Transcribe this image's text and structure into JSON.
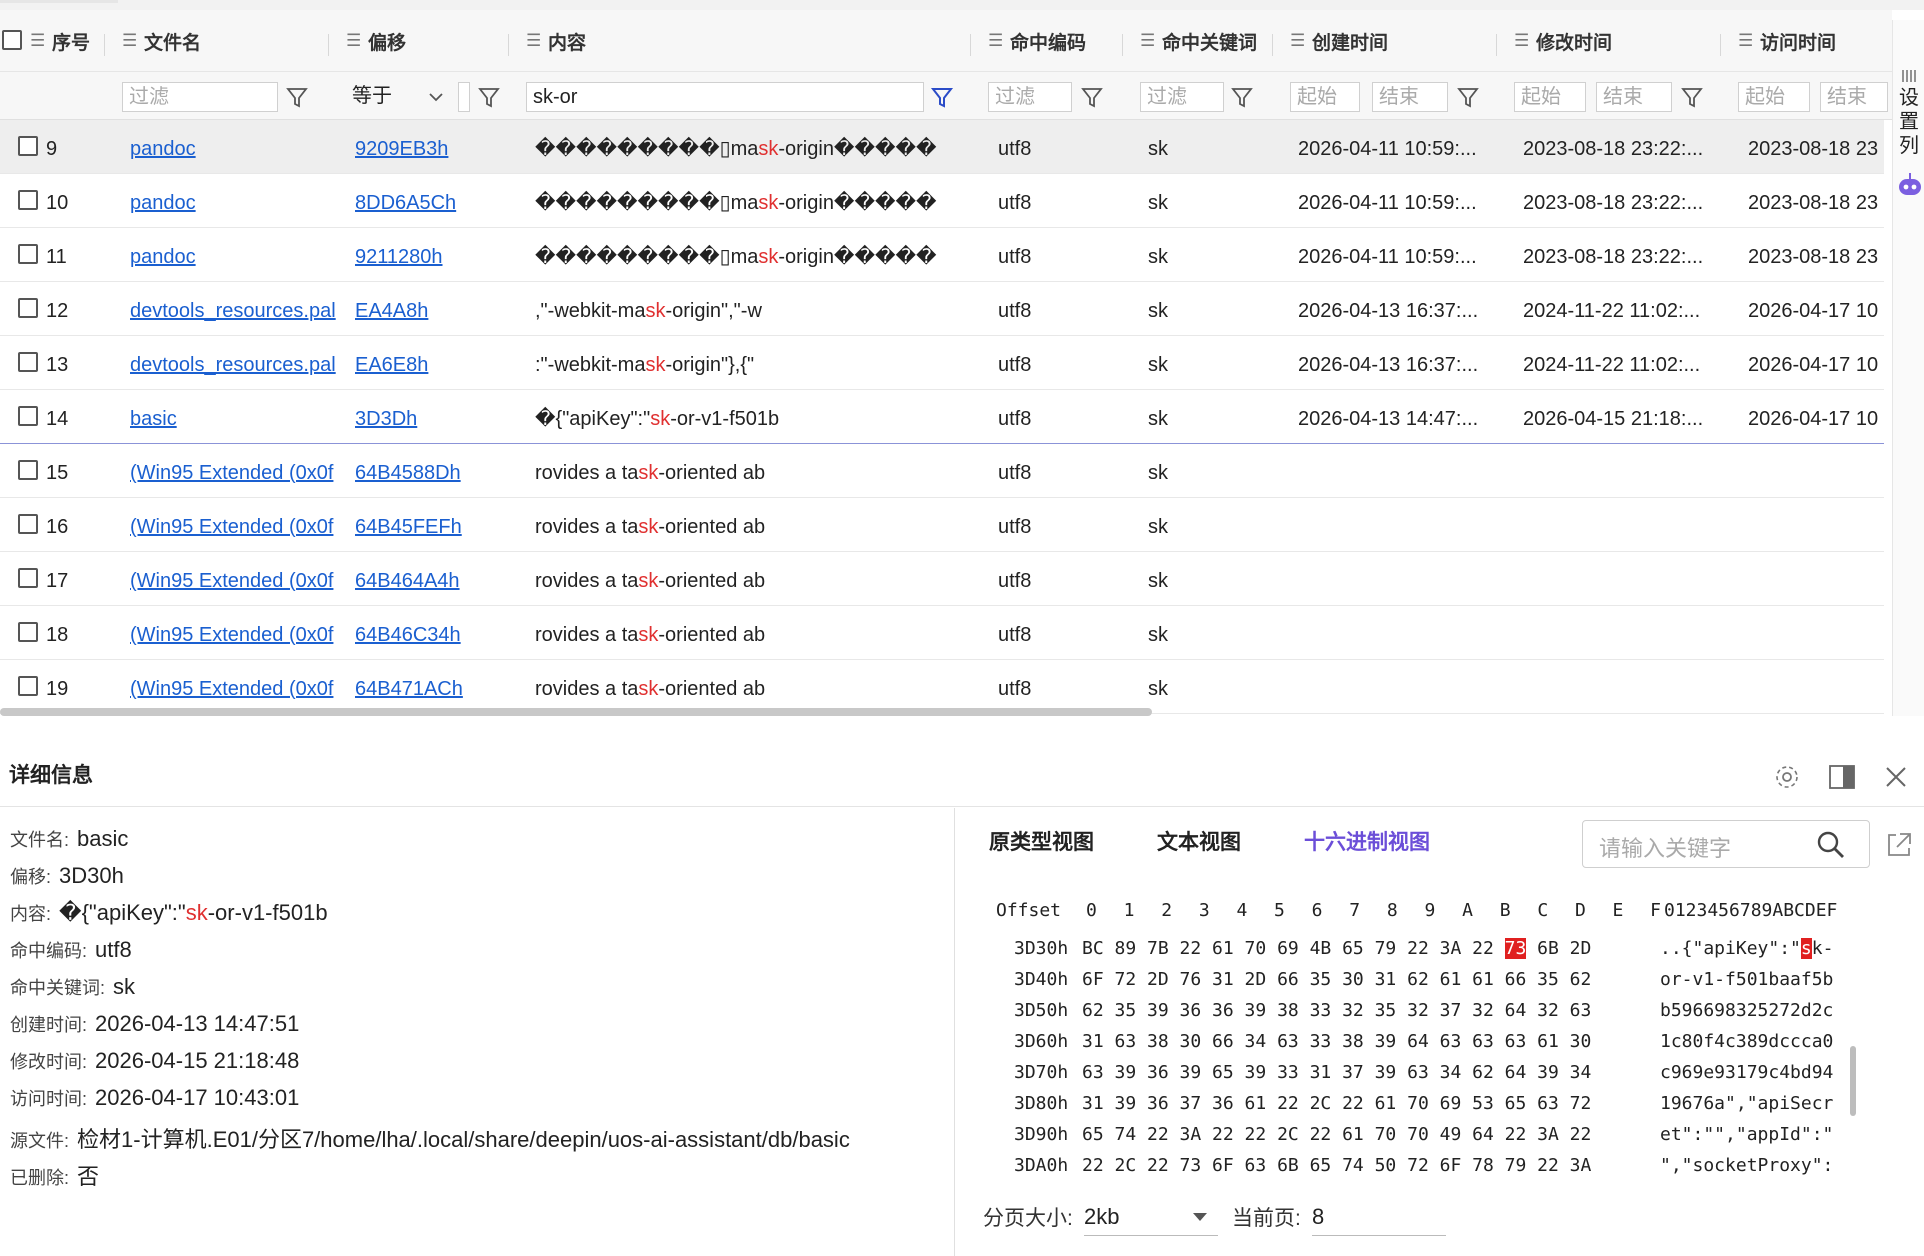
{
  "columns": {
    "index": "序号",
    "filename": "文件名",
    "offset": "偏移",
    "content": "内容",
    "encoding": "命中编码",
    "keyword": "命中关键词",
    "created": "创建时间",
    "modified": "修改时间",
    "accessed": "访问时间"
  },
  "filters": {
    "placeholder": "过滤",
    "offset_op": "等于",
    "content_value": "sk-or",
    "start": "起始",
    "end": "结束"
  },
  "side_label": "设置列",
  "rows": [
    {
      "idx": "9",
      "file": "pandoc",
      "offset": "9209EB3h",
      "pre": "���������▯ma",
      "hit": "sk",
      "post": "-origin�����",
      "enc": "utf8",
      "kw": "sk",
      "ctime": "2026-04-11 10:59:...",
      "mtime": "2023-08-18 23:22:...",
      "atime": "2023-08-18 23"
    },
    {
      "idx": "10",
      "file": "pandoc",
      "offset": "8DD6A5Ch",
      "pre": "���������▯ma",
      "hit": "sk",
      "post": "-origin�����",
      "enc": "utf8",
      "kw": "sk",
      "ctime": "2026-04-11 10:59:...",
      "mtime": "2023-08-18 23:22:...",
      "atime": "2023-08-18 23"
    },
    {
      "idx": "11",
      "file": "pandoc",
      "offset": "9211280h",
      "pre": "���������▯ma",
      "hit": "sk",
      "post": "-origin�����",
      "enc": "utf8",
      "kw": "sk",
      "ctime": "2026-04-11 10:59:...",
      "mtime": "2023-08-18 23:22:...",
      "atime": "2023-08-18 23"
    },
    {
      "idx": "12",
      "file": "devtools_resources.pal",
      "offset": "EA4A8h",
      "pre": ",\"-webkit-ma",
      "hit": "sk",
      "post": "-origin\",\"-w",
      "enc": "utf8",
      "kw": "sk",
      "ctime": "2026-04-13 16:37:...",
      "mtime": "2024-11-22 11:02:...",
      "atime": "2026-04-17 10"
    },
    {
      "idx": "13",
      "file": "devtools_resources.pal",
      "offset": "EA6E8h",
      "pre": ":\"-webkit-ma",
      "hit": "sk",
      "post": "-origin\"},{\"",
      "enc": "utf8",
      "kw": "sk",
      "ctime": "2026-04-13 16:37:...",
      "mtime": "2024-11-22 11:02:...",
      "atime": "2026-04-17 10"
    },
    {
      "idx": "14",
      "file": "basic",
      "offset": "3D3Dh",
      "pre": "�{\"apiKey\":\"",
      "hit": "sk",
      "post": "-or-v1-f501b",
      "enc": "utf8",
      "kw": "sk",
      "ctime": "2026-04-13 14:47:...",
      "mtime": "2026-04-15 21:18:...",
      "atime": "2026-04-17 10"
    },
    {
      "idx": "15",
      "file": "(Win95 Extended (0x0f",
      "offset": "64B4588Dh",
      "pre": "rovides a ta",
      "hit": "sk",
      "post": "-oriented ab",
      "enc": "utf8",
      "kw": "sk",
      "ctime": "",
      "mtime": "",
      "atime": ""
    },
    {
      "idx": "16",
      "file": "(Win95 Extended (0x0f",
      "offset": "64B45FEFh",
      "pre": "rovides a ta",
      "hit": "sk",
      "post": "-oriented ab",
      "enc": "utf8",
      "kw": "sk",
      "ctime": "",
      "mtime": "",
      "atime": ""
    },
    {
      "idx": "17",
      "file": "(Win95 Extended (0x0f",
      "offset": "64B464A4h",
      "pre": "rovides a ta",
      "hit": "sk",
      "post": "-oriented ab",
      "enc": "utf8",
      "kw": "sk",
      "ctime": "",
      "mtime": "",
      "atime": ""
    },
    {
      "idx": "18",
      "file": "(Win95 Extended (0x0f",
      "offset": "64B46C34h",
      "pre": "rovides a ta",
      "hit": "sk",
      "post": "-oriented ab",
      "enc": "utf8",
      "kw": "sk",
      "ctime": "",
      "mtime": "",
      "atime": ""
    },
    {
      "idx": "19",
      "file": "(Win95 Extended (0x0f",
      "offset": "64B471ACh",
      "pre": "rovides a ta",
      "hit": "sk",
      "post": "-oriented ab",
      "enc": "utf8",
      "kw": "sk",
      "ctime": "",
      "mtime": "",
      "atime": ""
    }
  ],
  "detail": {
    "title": "详细信息",
    "fields": {
      "filename_label": "文件名:",
      "filename": "basic",
      "offset_label": "偏移:",
      "offset": "3D30h",
      "content_label": "内容:",
      "content_pre": "�{\"apiKey\":\"",
      "content_hit": "sk",
      "content_post": "-or-v1-f501b",
      "encoding_label": "命中编码:",
      "encoding": "utf8",
      "keyword_label": "命中关键词:",
      "keyword": "sk",
      "created_label": "创建时间:",
      "created": "2026-04-13 14:47:51",
      "modified_label": "修改时间:",
      "modified": "2026-04-15 21:18:48",
      "accessed_label": "访问时间:",
      "accessed": "2026-04-17 10:43:01",
      "source_label": "源文件:",
      "source": "检材1-计算机.E01/分区7/home/lha/.local/share/deepin/uos-ai-assistant/db/basic",
      "deleted_label": "已删除:",
      "deleted": "否"
    },
    "tabs": {
      "raw": "原类型视图",
      "text": "文本视图",
      "hex": "十六进制视图"
    },
    "search_placeholder": "请输入关键字",
    "hex": {
      "header_offset": "Offset",
      "header_cols": "0  1  2  3  4  5  6  7  8  9  A  B  C  D  E  F",
      "header_ascii": "0123456789ABCDEF",
      "lines": [
        {
          "off": "3D30h",
          "pre": "BC 89 7B 22 61 70 69 4B 65 79 22 3A 22 ",
          "hit": "73",
          "post": " 6B 2D",
          "apre": "..{\"apiKey\":\"",
          "ahit": "s",
          "apost": "k-"
        },
        {
          "off": "3D40h",
          "pre": "6F 72 2D 76 31 2D 66 35 30 31 62 61 61 66 35 62",
          "hit": "",
          "post": "",
          "apre": "or-v1-f501baaf5b",
          "ahit": "",
          "apost": ""
        },
        {
          "off": "3D50h",
          "pre": "62 35 39 36 36 39 38 33 32 35 32 37 32 64 32 63",
          "hit": "",
          "post": "",
          "apre": "b596698325272d2c",
          "ahit": "",
          "apost": ""
        },
        {
          "off": "3D60h",
          "pre": "31 63 38 30 66 34 63 33 38 39 64 63 63 63 61 30",
          "hit": "",
          "post": "",
          "apre": "1c80f4c389dccca0",
          "ahit": "",
          "apost": ""
        },
        {
          "off": "3D70h",
          "pre": "63 39 36 39 65 39 33 31 37 39 63 34 62 64 39 34",
          "hit": "",
          "post": "",
          "apre": "c969e93179c4bd94",
          "ahit": "",
          "apost": ""
        },
        {
          "off": "3D80h",
          "pre": "31 39 36 37 36 61 22 2C 22 61 70 69 53 65 63 72",
          "hit": "",
          "post": "",
          "apre": "19676a\",\"apiSecr",
          "ahit": "",
          "apost": ""
        },
        {
          "off": "3D90h",
          "pre": "65 74 22 3A 22 22 2C 22 61 70 70 49 64 22 3A 22",
          "hit": "",
          "post": "",
          "apre": "et\":\"\",\"appId\":\"",
          "ahit": "",
          "apost": ""
        },
        {
          "off": "3DA0h",
          "pre": "22 2C 22 73 6F 63 6B 65 74 50 72 6F 78 79 22 3A",
          "hit": "",
          "post": "",
          "apre": "\",\"socketProxy\":",
          "ahit": "",
          "apost": ""
        }
      ]
    },
    "pager": {
      "size_label": "分页大小:",
      "size": "2kb",
      "page_label": "当前页:",
      "page": "8"
    }
  },
  "colors": {
    "accent": "#6b4ed8",
    "link": "#1a5fd0",
    "highlight": "#e03030"
  }
}
